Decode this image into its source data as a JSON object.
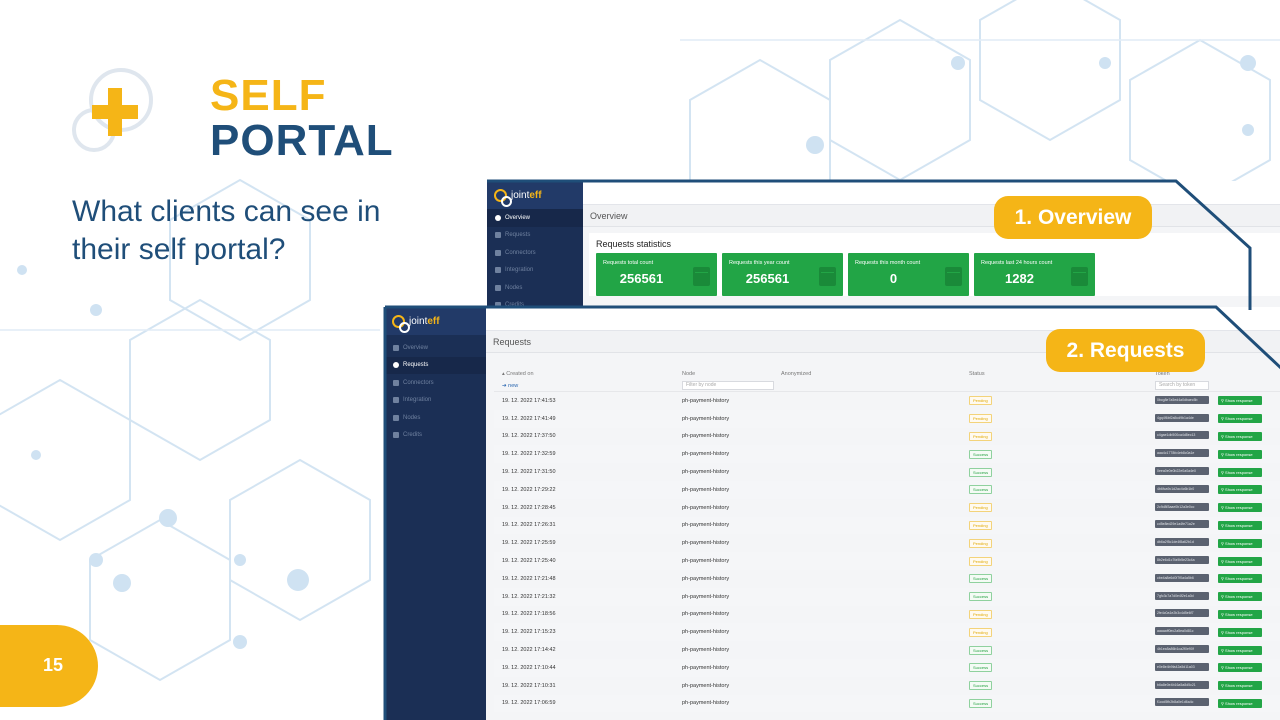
{
  "slide": {
    "title_line1": "SELF",
    "title_line2": "PORTAL",
    "subtitle": "What clients can see in their self portal?",
    "page_number": "15",
    "callout_overview": "1. Overview",
    "callout_requests": "2. Requests",
    "colors": {
      "accent_yellow": "#f5b517",
      "navy": "#1f4e79",
      "green": "#22a546",
      "sidebar": "#1b2f55"
    }
  },
  "app": {
    "brand_prefix": "joint",
    "brand_suffix": "eff",
    "nav": [
      "Overview",
      "Requests",
      "Connectors",
      "Integration",
      "Nodes",
      "Credits"
    ]
  },
  "overview": {
    "page_title": "Overview",
    "panel_title": "Requests statistics",
    "cards": [
      {
        "label": "Requests total count",
        "value": "256561"
      },
      {
        "label": "Requests this year count",
        "value": "256561"
      },
      {
        "label": "Requests this month count",
        "value": "0"
      },
      {
        "label": "Requests last 24 hours count",
        "value": "1282"
      }
    ]
  },
  "requests": {
    "page_title": "Requests",
    "columns": {
      "created_on": "Created on",
      "node": "Node",
      "anonymized": "Anonymized",
      "status": "Status",
      "token": "Token"
    },
    "new_link": "new",
    "node_filter_placeholder": "Filter by node",
    "token_filter_placeholder": "Search by token",
    "show_label": "Show response",
    "rows": [
      {
        "date": "19. 12. 2022 17:41:53",
        "node": "ph-payment-history",
        "status": "Pending",
        "token": "0bcg8e7a5ed4a0dbaec5b"
      },
      {
        "date": "19. 12. 2022 17:41:49",
        "node": "ph-payment-history",
        "status": "Pending",
        "token": "4gq4f6bf2a5cd9b1a4de"
      },
      {
        "date": "19. 12. 2022 17:37:50",
        "node": "ph-payment-history",
        "status": "Pending",
        "token": "c4gae1db500ca4d8ec13"
      },
      {
        "date": "19. 12. 2022 17:32:59",
        "node": "ph-payment-history",
        "status": "Success",
        "token": "aaa4c1778fc4eb8c0a1e"
      },
      {
        "date": "19. 12. 2022 17:31:50",
        "node": "ph-payment-history",
        "status": "Success",
        "token": "0eea0e0e0b22e0a0a4e0"
      },
      {
        "date": "19. 12. 2022 17:29:22",
        "node": "ph-payment-history",
        "status": "Success",
        "token": "4b6fca9c1d2ac4c6b1b0"
      },
      {
        "date": "19. 12. 2022 17:28:45",
        "node": "ph-payment-history",
        "status": "Pending",
        "token": "2c9d8f3aae0b12a3e0cc"
      },
      {
        "date": "19. 12. 2022 17:26:31",
        "node": "ph-payment-history",
        "status": "Pending",
        "token": "cd5e8ed29e1a4fe71a2e"
      },
      {
        "date": "19. 12. 2022 17:25:59",
        "node": "ph-payment-history",
        "status": "Pending",
        "token": "db6a2f5c1de4f8a62b1d"
      },
      {
        "date": "19. 12. 2022 17:25:40",
        "node": "ph-payment-history",
        "status": "Pending",
        "token": "8b2e6d1c7fa9b5e23c4a"
      },
      {
        "date": "19. 12. 2022 17:21:48",
        "node": "ph-payment-history",
        "status": "Success",
        "token": "cbe4a8e6d0f7f0a4a5b6"
      },
      {
        "date": "19. 12. 2022 17:21:32",
        "node": "ph-payment-history",
        "status": "Success",
        "token": "7gfc3c7a7d0e4f2e1a0d"
      },
      {
        "date": "19. 12. 2022 17:18:56",
        "node": "ph-payment-history",
        "status": "Pending",
        "token": "2fe4c0a1e2b3c4d5e6f7"
      },
      {
        "date": "19. 12. 2022 17:15:23",
        "node": "ph-payment-history",
        "status": "Pending",
        "token": "aaaaaff0ec2a5ea0d81c"
      },
      {
        "date": "19. 12. 2022 17:14:42",
        "node": "ph-payment-history",
        "status": "Success",
        "token": "4b1ea5a86b1ca2f0e90f"
      },
      {
        "date": "19. 12. 2022 17:10:44",
        "node": "ph-payment-history",
        "status": "Success",
        "token": "e0e8e4b9fa42a5d11a03"
      },
      {
        "date": "19. 12. 2022 17:10:31",
        "node": "ph-payment-history",
        "status": "Success",
        "token": "b6a8e0e4b16a5a8d5c21"
      },
      {
        "date": "19. 12. 2022 17:06:59",
        "node": "ph-payment-history",
        "status": "Success",
        "token": "f1ccd5fb2b8a0e1d6a4c"
      }
    ]
  }
}
